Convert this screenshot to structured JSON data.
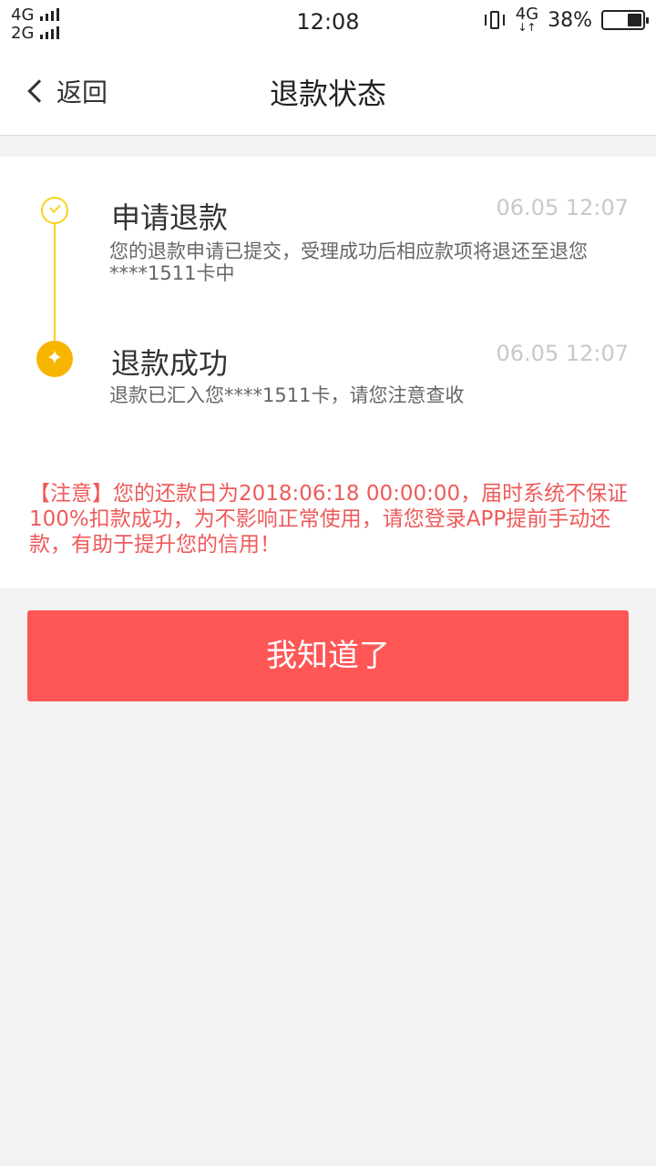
{
  "status_bar": {
    "sim1_label": "4G",
    "sim2_label": "2G",
    "time": "12:08",
    "network": "4G",
    "battery_percent": "38%",
    "battery_level": 0.38,
    "icons": [
      "signal-icon",
      "vibrate-icon",
      "data-arrows-icon",
      "battery-icon"
    ]
  },
  "nav": {
    "back_label": "返回",
    "title": "退款状态"
  },
  "steps": [
    {
      "title": "申请退款",
      "time": "06.05 12:07",
      "desc": "您的退款申请已提交，受理成功后相应款项将退还至退您****1511卡中",
      "icon": "check-circle-icon",
      "state": "done"
    },
    {
      "title": "退款成功",
      "time": "06.05 12:07",
      "desc": "退款已汇入您****1511卡，请您注意查收",
      "icon": "sparkle-icon",
      "state": "current"
    }
  ],
  "notice": "【注意】您的还款日为2018:06:18 00:00:00，届时系统不保证100%扣款成功，为不影响正常使用，请您登录APP提前手动还款，有助于提升您的信用！",
  "confirm_button": "我知道了",
  "colors": {
    "accent": "#ff5656",
    "timeline": "#f5d21f",
    "current_step": "#f7b500",
    "notice_text": "#ef5a5a"
  }
}
